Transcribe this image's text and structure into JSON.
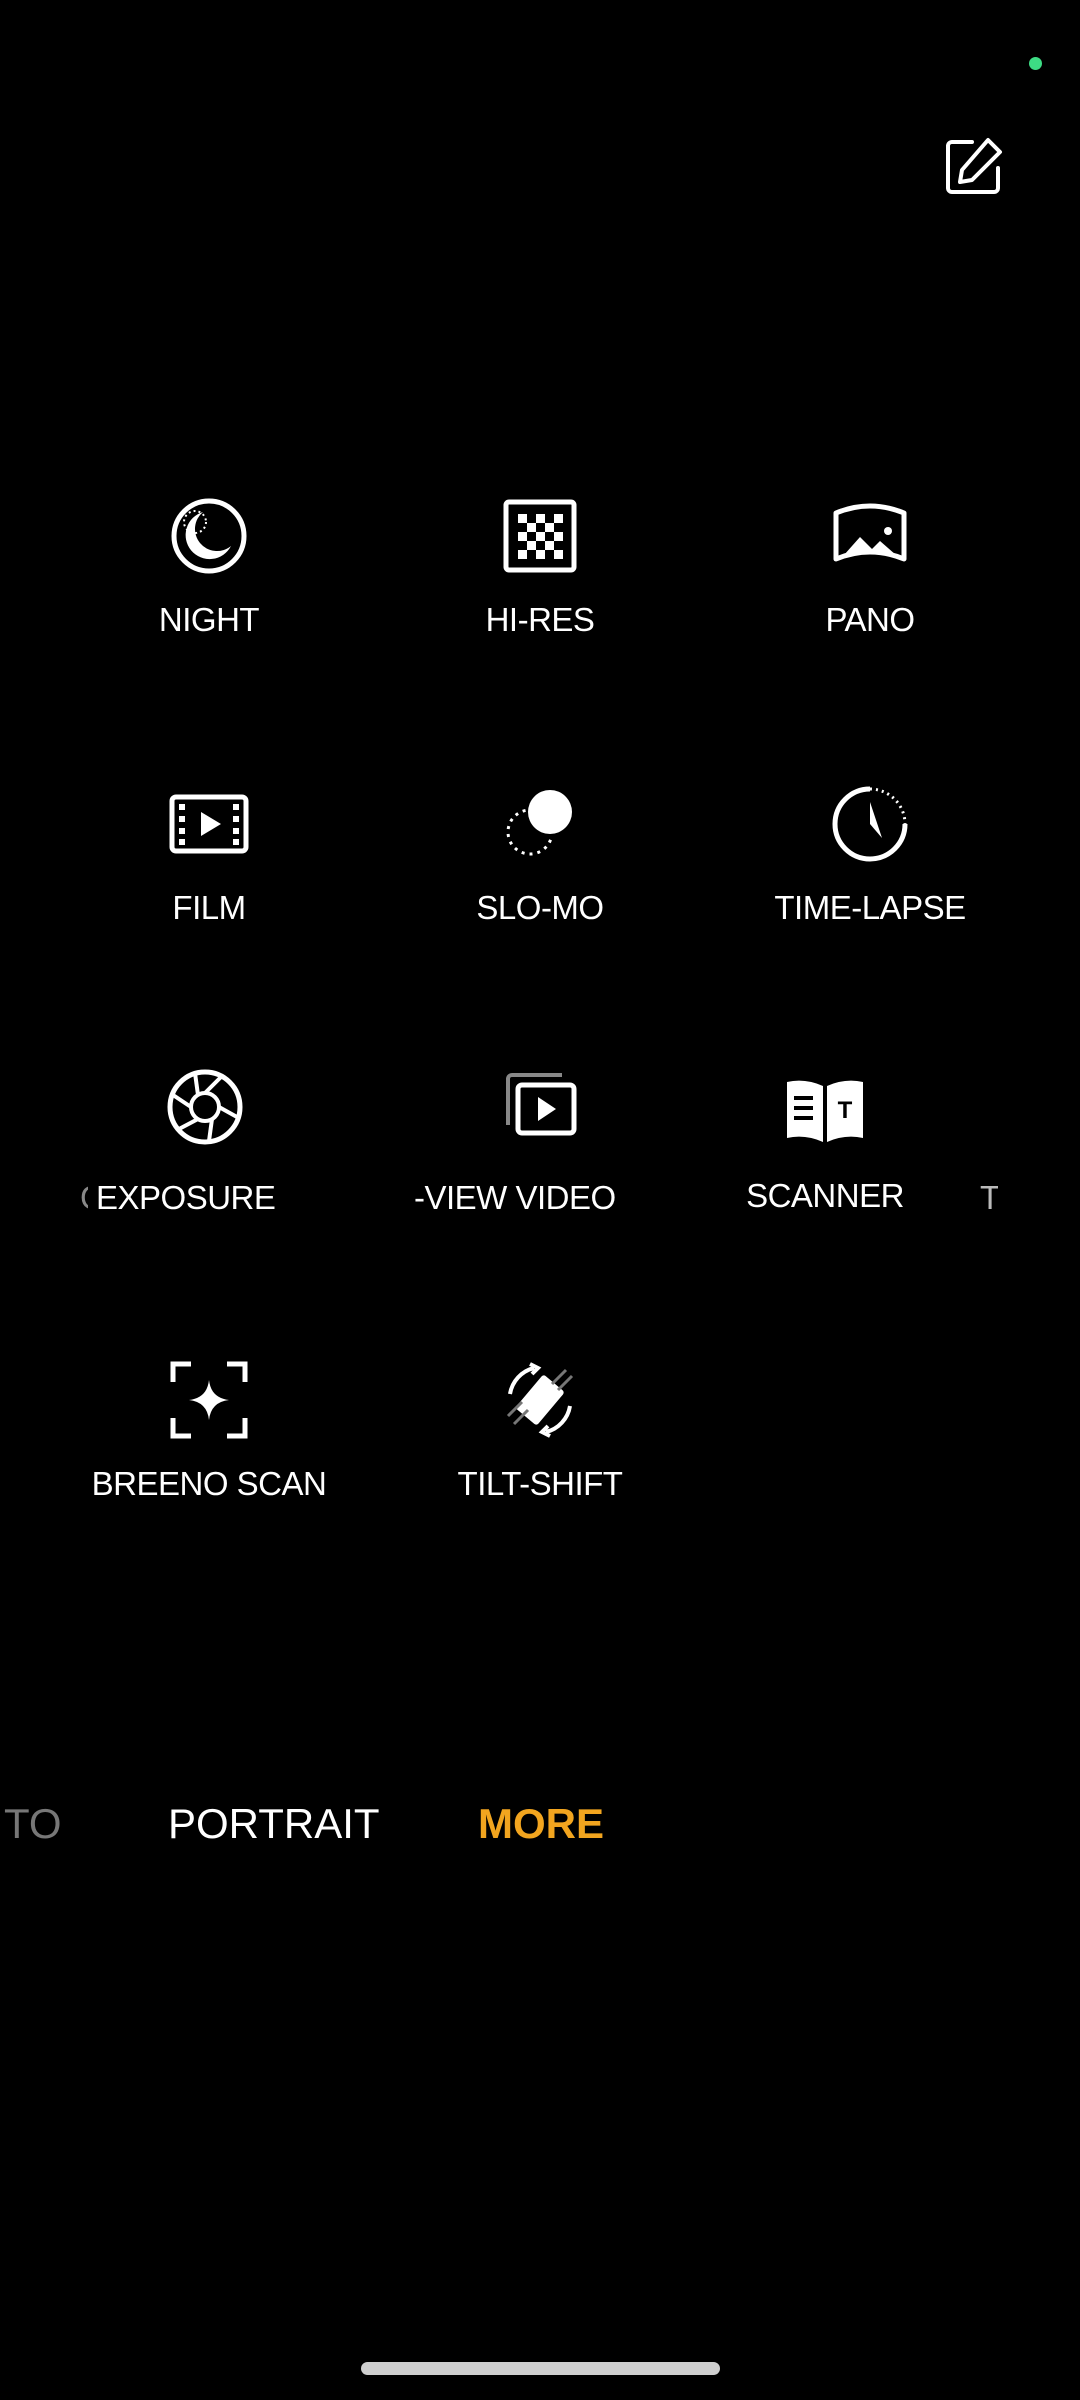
{
  "header": {
    "edit_icon": "edit-icon"
  },
  "modes": {
    "night": "NIGHT",
    "hi_res": "HI-RES",
    "pano": "PANO",
    "film": "FILM",
    "slo_mo": "SLO-MO",
    "time_lapse": "TIME-LAPSE",
    "long_exposure_partial": "EXPOSURE",
    "dual_view_partial": "-VIEW VIDEO",
    "scanner": "SCANNER",
    "next_partial": "T",
    "breeno_scan": "BREENO SCAN",
    "tilt_shift": "TILT-SHIFT"
  },
  "bottom_bar": {
    "prev_partial": "TO",
    "portrait": "PORTRAIT",
    "more": "MORE"
  },
  "colors": {
    "active_mode": "#F2A51F",
    "status_dot": "#3DDC84",
    "background": "#000000"
  }
}
